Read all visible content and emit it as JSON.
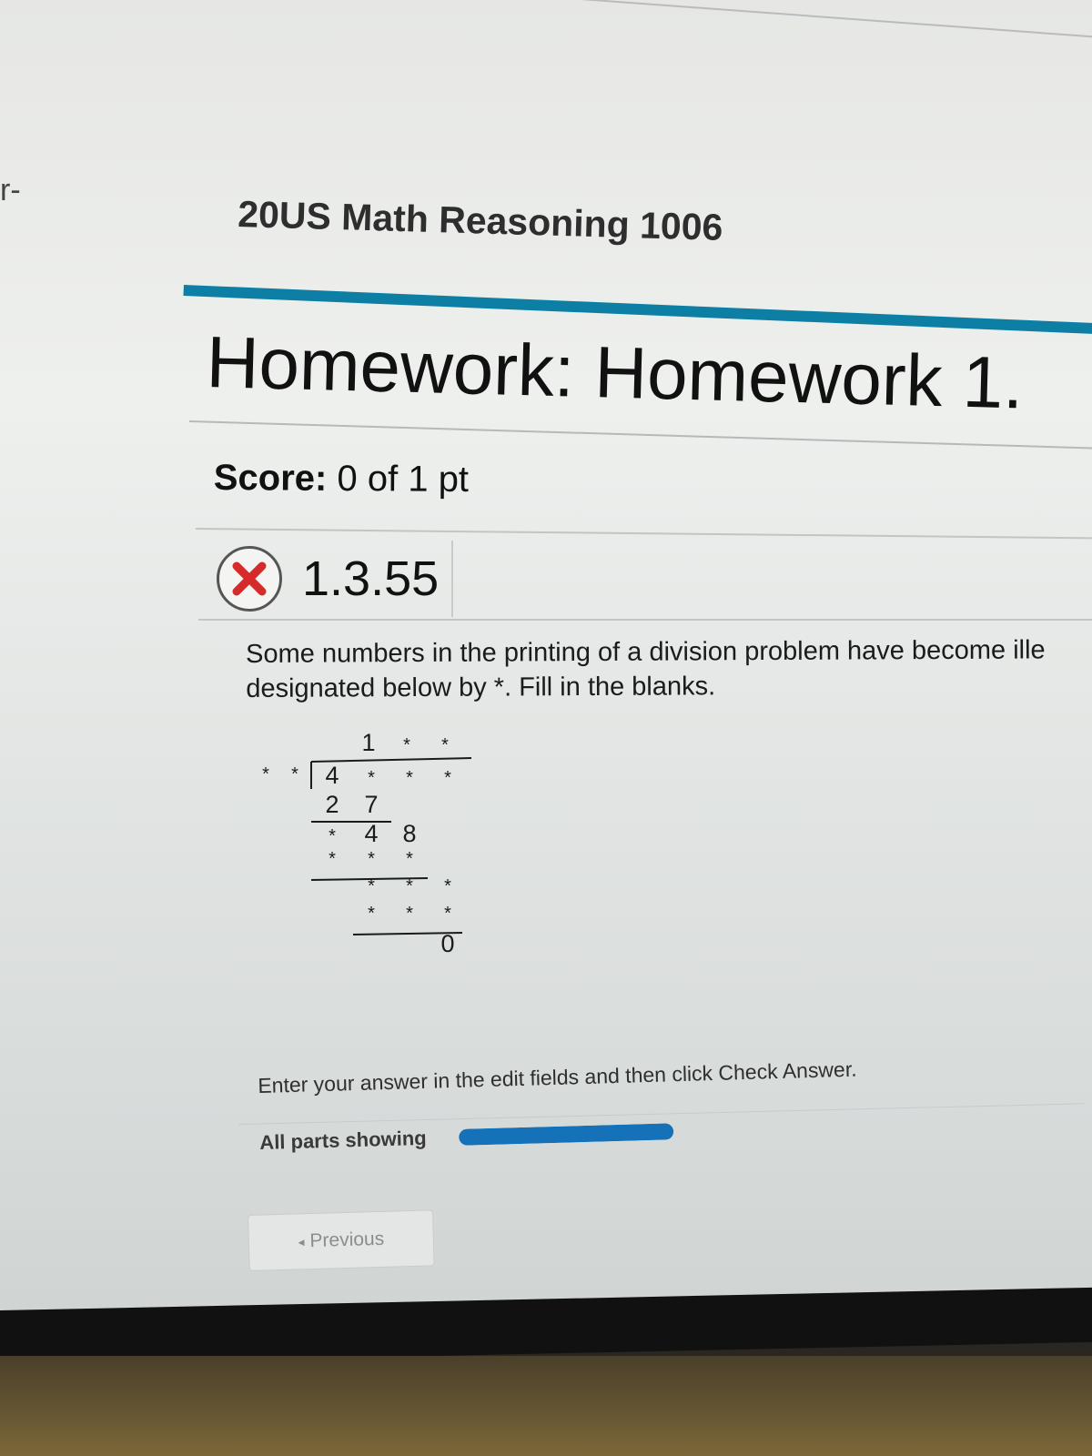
{
  "edge_text": "r-",
  "course_title": "20US Math Reasoning 1006",
  "homework_title": "Homework: Homework 1.",
  "score": {
    "label": "Score:",
    "value": "0 of 1 pt"
  },
  "question": {
    "number": "1.3.55",
    "status": "incorrect",
    "status_icon": "x-circle-icon"
  },
  "problem_text": {
    "line1": "Some numbers in the printing of a division problem have become ille",
    "line2": "designated below by *. Fill in the blanks."
  },
  "division": {
    "quotient": [
      "1",
      "*",
      "*"
    ],
    "divisor": [
      "*",
      "*"
    ],
    "dividend": [
      "4",
      "*",
      "*",
      "*"
    ],
    "rows": [
      [
        "2",
        "7"
      ],
      [
        "*",
        "4",
        "8"
      ],
      [
        "*",
        "*",
        "*"
      ],
      [
        "*",
        "*",
        "*"
      ],
      [
        "*",
        "*",
        "*"
      ],
      [
        "0"
      ]
    ]
  },
  "instruction": "Enter your answer in the edit fields and then click Check Answer.",
  "parts": {
    "label": "All parts showing",
    "progress": 1.0
  },
  "previous_button": "Previous",
  "colors": {
    "accent": "#0e7fa4",
    "progress": "#1572b8",
    "error": "#d52b2b"
  }
}
